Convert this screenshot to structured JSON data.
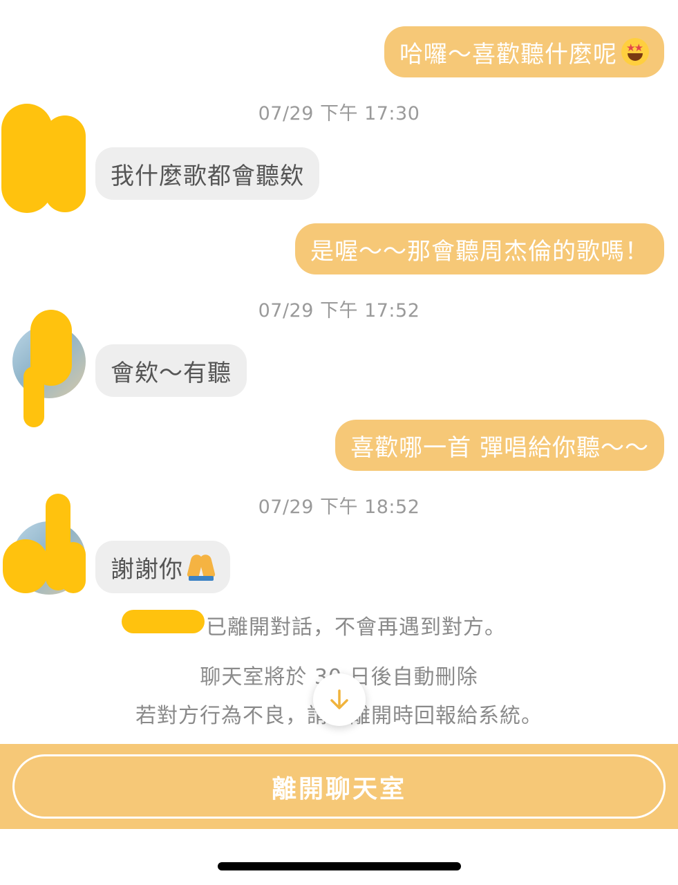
{
  "colors": {
    "accent_out": "#f6c877",
    "bubble_in": "#eeeeee",
    "redaction": "#ffc20e"
  },
  "messages": [
    {
      "side": "out",
      "text": "哈囉～喜歡聽什麼呢",
      "emoji": "star-struck-emoji"
    },
    {
      "side": "timestamp",
      "text": "07/29 下午 17:30"
    },
    {
      "side": "in",
      "text": "我什麼歌都會聽欸"
    },
    {
      "side": "out",
      "text": "是喔～～那會聽周杰倫的歌嗎！"
    },
    {
      "side": "timestamp",
      "text": "07/29 下午 17:52"
    },
    {
      "side": "in",
      "text": "會欸～有聽"
    },
    {
      "side": "out",
      "text": "喜歡哪一首 彈唱給你聽～～"
    },
    {
      "side": "timestamp",
      "text": "07/29 下午 18:52"
    },
    {
      "side": "in",
      "text": "謝謝你",
      "emoji": "folded-hands-emoji"
    }
  ],
  "system": {
    "left_notice": "已離開對話，不會再遇到對方。",
    "delete_notice": "聊天室將於 30 日後自動刪除",
    "report_notice": "若對方行為不良，請於離開時回報給系統。"
  },
  "scroll_button": {
    "icon": "arrow-down-icon"
  },
  "leave_button": {
    "label": "離開聊天室"
  }
}
